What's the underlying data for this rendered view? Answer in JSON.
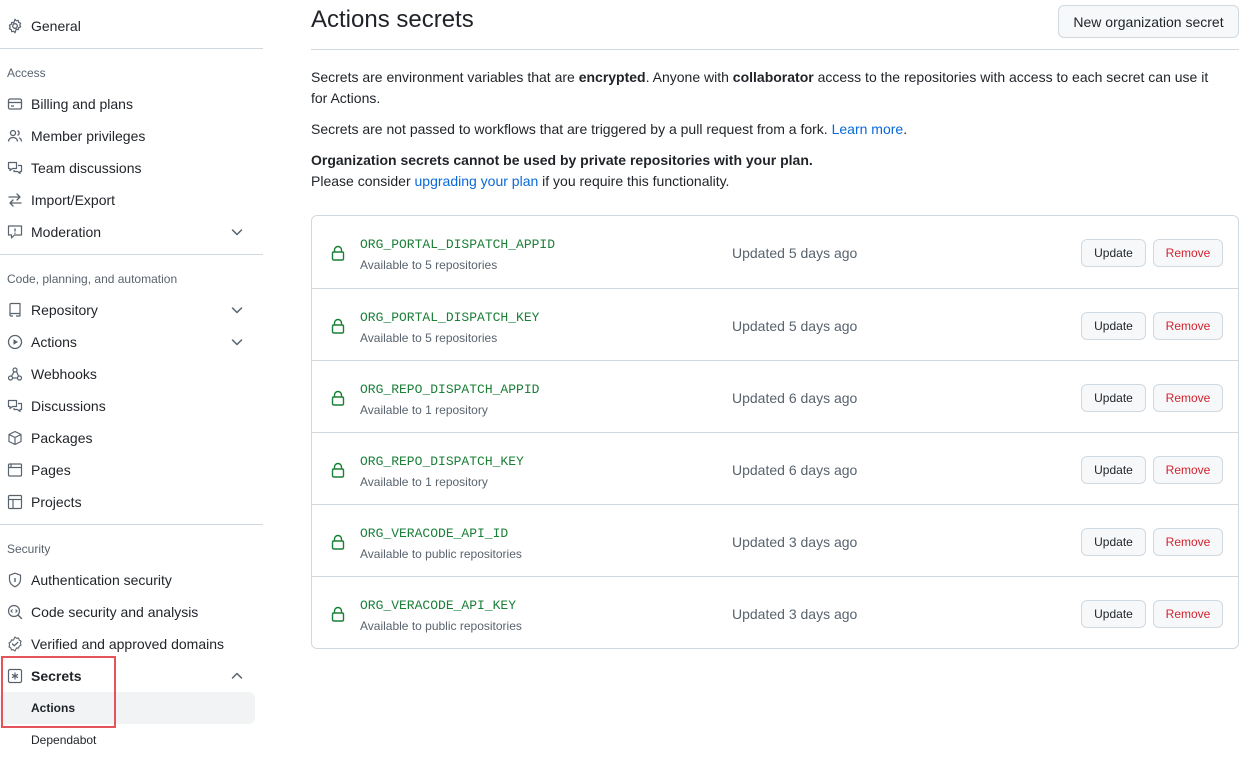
{
  "sidebar": {
    "general": "General",
    "sections": {
      "access": "Access",
      "code": "Code, planning, and automation",
      "security": "Security"
    },
    "items": {
      "billing": "Billing and plans",
      "members": "Member privileges",
      "team": "Team discussions",
      "import": "Import/Export",
      "moderation": "Moderation",
      "repository": "Repository",
      "actions": "Actions",
      "webhooks": "Webhooks",
      "discussions": "Discussions",
      "packages": "Packages",
      "pages": "Pages",
      "projects": "Projects",
      "auth": "Authentication security",
      "codesec": "Code security and analysis",
      "domains": "Verified and approved domains",
      "secrets": "Secrets"
    },
    "sub": {
      "actions": "Actions",
      "dependabot": "Dependabot"
    }
  },
  "header": {
    "title": "Actions secrets",
    "new_button": "New organization secret"
  },
  "intro": {
    "p1_a": "Secrets are environment variables that are ",
    "p1_b": "encrypted",
    "p1_c": ". Anyone with ",
    "p1_d": "collaborator",
    "p1_e": " access to the repositories with access to each secret can use it for Actions.",
    "p2_a": "Secrets are not passed to workflows that are triggered by a pull request from a fork. ",
    "p2_link": "Learn more",
    "p2_b": ".",
    "p3_bold": "Organization secrets cannot be used by private repositories with your plan.",
    "p3_a": "Please consider ",
    "p3_link": "upgrading your plan",
    "p3_b": " if you require this functionality."
  },
  "secrets": [
    {
      "name": "ORG_PORTAL_DISPATCH_APPID",
      "avail_prefix": "Available to ",
      "avail_value": "5 repositories",
      "updated": "Updated 5 days ago",
      "update": "Update",
      "remove": "Remove"
    },
    {
      "name": "ORG_PORTAL_DISPATCH_KEY",
      "avail_prefix": "Available to ",
      "avail_value": "5 repositories",
      "updated": "Updated 5 days ago",
      "update": "Update",
      "remove": "Remove"
    },
    {
      "name": "ORG_REPO_DISPATCH_APPID",
      "avail_prefix": "Available to ",
      "avail_value": "1 repository",
      "updated": "Updated 6 days ago",
      "update": "Update",
      "remove": "Remove"
    },
    {
      "name": "ORG_REPO_DISPATCH_KEY",
      "avail_prefix": "Available to ",
      "avail_value": "1 repository",
      "updated": "Updated 6 days ago",
      "update": "Update",
      "remove": "Remove"
    },
    {
      "name": "ORG_VERACODE_API_ID",
      "avail_prefix": "Available to ",
      "avail_value": "public repositories",
      "updated": "Updated 3 days ago",
      "update": "Update",
      "remove": "Remove"
    },
    {
      "name": "ORG_VERACODE_API_KEY",
      "avail_prefix": "Available to ",
      "avail_value": "public repositories",
      "updated": "Updated 3 days ago",
      "update": "Update",
      "remove": "Remove"
    }
  ],
  "colors": {
    "accent_link": "#0969da",
    "secret_green": "#1a7f37",
    "remove_red": "#d1242f",
    "highlight_red": "#e5535b"
  }
}
